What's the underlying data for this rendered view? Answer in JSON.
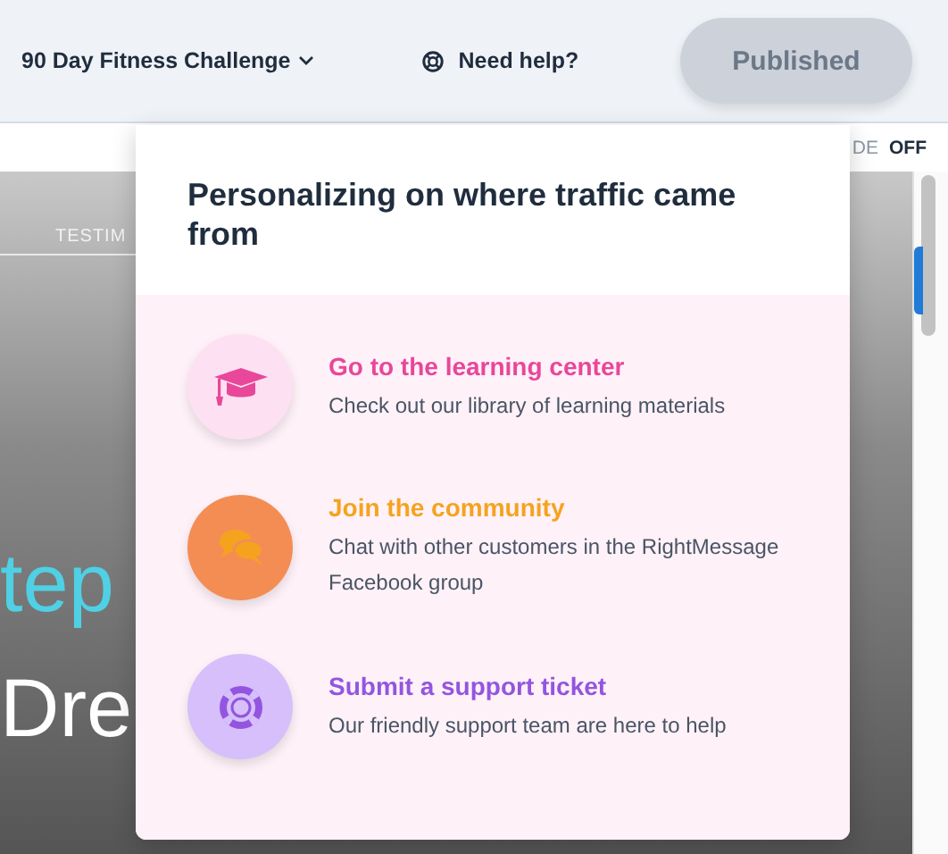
{
  "header": {
    "project": "90 Day Fitness Challenge",
    "help": "Need help?",
    "publish_button": "Published"
  },
  "toggle": {
    "label": "DE",
    "state": "OFF"
  },
  "hero": {
    "nav_item": "TESTIM",
    "headline_1": "tep",
    "headline_2": "Dre"
  },
  "popup": {
    "title": "Personalizing on where traffic came from",
    "items": [
      {
        "kind": "learning",
        "title": "Go to the learning center",
        "description": "Check out our library of learning materials",
        "color": "#e8479a"
      },
      {
        "kind": "community",
        "title": "Join the community",
        "description": "Chat with other customers in the RightMessage Facebook group",
        "color": "#f5a31f"
      },
      {
        "kind": "support",
        "title": "Submit a support ticket",
        "description": "Our friendly support team are here to help",
        "color": "#9355e0"
      }
    ]
  }
}
